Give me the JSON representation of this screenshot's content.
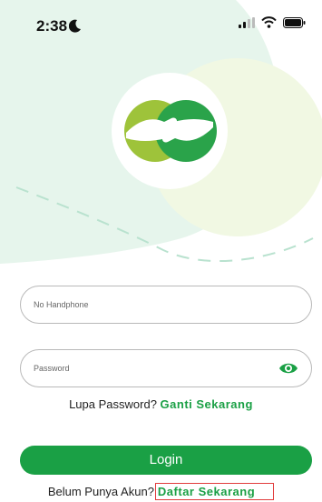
{
  "status_bar": {
    "time": "2:38",
    "moon_icon": "moon-icon",
    "signal_icon": "signal-icon",
    "wifi_icon": "wifi-icon",
    "battery_icon": "battery-icon"
  },
  "form": {
    "phone_placeholder": "No Handphone",
    "password_placeholder": "Password",
    "eye_icon": "eye-icon",
    "forgot_text": "Lupa Password?",
    "forgot_link": "Ganti Sekarang",
    "login_label": "Login",
    "register_text": "Belum Punya Akun?",
    "register_link": "Daftar Sekarang"
  },
  "colors": {
    "primary": "#1aa045",
    "hero_bg": "#e4f4ea",
    "highlight_border": "#e13c3c"
  }
}
